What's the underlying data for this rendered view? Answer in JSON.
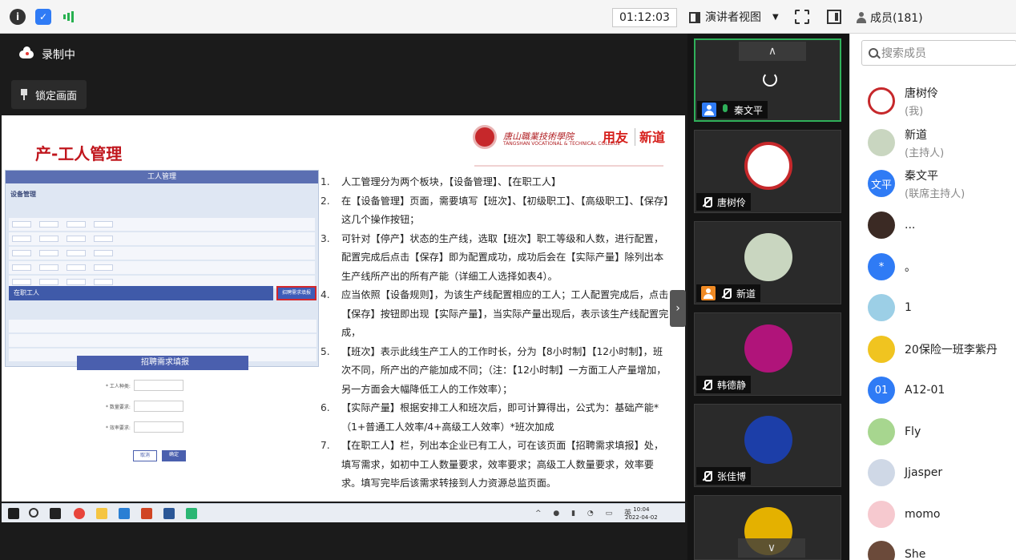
{
  "toolbar": {
    "timer": "01:12:03",
    "presenter_view": "演讲者视图",
    "members_label": "成员(181)"
  },
  "stage": {
    "recording": "录制中",
    "lock_screen": "锁定画面",
    "expand_glyph": "›"
  },
  "slide": {
    "title": "产-工人管理",
    "school_name": "唐山職業技術學院",
    "school_en": "TANGSHAN VOCATIONAL & TECHNICAL COLLEGE",
    "brand1": "用友",
    "brand2": "新道",
    "screenshot": {
      "window_title": "工人管理",
      "section1": "设备管理",
      "section2": "在职工人",
      "hire_button": "招聘需求填报",
      "dialog_title": "招聘需求填报",
      "field1": "* 工人种类:",
      "field2": "* 数量要求:",
      "field3": "* 效率要求:",
      "cancel": "取消",
      "ok": "确定"
    },
    "points": [
      {
        "n": "1.",
        "text": "人工管理分为两个板块，【设备管理】、【在职工人】"
      },
      {
        "n": "2.",
        "text": "在【设备管理】页面，需要填写【班次】、【初级职工】、【高级职工】、【保存】这几个操作按钮；"
      },
      {
        "n": "3.",
        "text": "可针对【停产】状态的生产线，选取【班次】职工等级和人数，进行配置，配置完成后点击【保存】即为配置成功，成功后会在【实际产量】除列出本生产线所产出的所有产能（详细工人选择如表4）。"
      },
      {
        "n": "4.",
        "text": "应当依照【设备规则】，为该生产线配置相应的工人；工人配置完成后，点击【保存】按钮即出现【实际产量】，当实际产量出现后，表示该生产线配置完成，"
      },
      {
        "n": "5.",
        "text": "【班次】表示此线生产工人的工作时长，分为【8小时制】【12小时制】，班次不同，所产出的产能加成不同；（注：【12小时制】一方面工人产量增加，另一方面会大幅降低工人的工作效率）；"
      },
      {
        "n": "6.",
        "text": "【实际产量】根据安排工人和班次后，即可计算得出，公式为：基础产能*（1+普通工人效率/4+高级工人效率）*班次加成"
      },
      {
        "n": "7.",
        "text": "【在职工人】栏，列出本企业已有工人，可在该页面【招聘需求填报】处，填写需求，如初中工人数量要求，效率要求；高级工人数量要求，效率要求。填写完毕后该需求转接到人力资源总监页面。"
      }
    ],
    "badge": "产",
    "clock_time": "10:04",
    "clock_date": "2022-04-02"
  },
  "videos": [
    {
      "name": "秦文平",
      "state": "loading"
    },
    {
      "name": "唐树伶",
      "state": "logo"
    },
    {
      "name": "新道",
      "state": "avatar"
    },
    {
      "name": "韩德静",
      "state": "avatar"
    },
    {
      "name": "张佳博",
      "state": "avatar"
    }
  ],
  "members": {
    "search_placeholder": "搜索成员",
    "list": [
      {
        "name": "唐树伶",
        "role": "(我)",
        "avatar": "logo"
      },
      {
        "name": "新道",
        "role": "(主持人)",
        "avatar": "img"
      },
      {
        "name": "秦文平",
        "role": "(联席主持人)",
        "avatar": "文平"
      },
      {
        "name": "...",
        "role": "",
        "avatar": "img"
      },
      {
        "name": "。",
        "role": "",
        "avatar": "*"
      },
      {
        "name": "1",
        "role": "",
        "avatar": "img"
      },
      {
        "name": "20保险一班李紫丹",
        "role": "",
        "avatar": "img"
      },
      {
        "name": "A12-01",
        "role": "",
        "avatar": "01"
      },
      {
        "name": "Fly",
        "role": "",
        "avatar": "img"
      },
      {
        "name": "Jjasper",
        "role": "",
        "avatar": "img"
      },
      {
        "name": "momo",
        "role": "",
        "avatar": "img"
      },
      {
        "name": "She",
        "role": "",
        "avatar": "img"
      }
    ]
  }
}
